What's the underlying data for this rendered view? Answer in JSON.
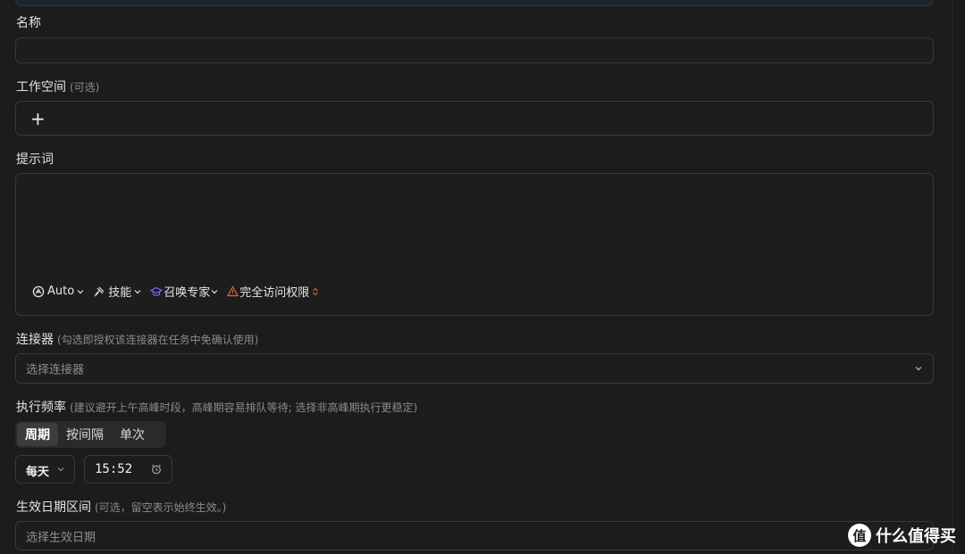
{
  "name": {
    "label": "名称",
    "value": ""
  },
  "workspace": {
    "label": "工作空间",
    "hint": "(可选)",
    "add_symbol": "+"
  },
  "prompt": {
    "label": "提示词",
    "value": "",
    "toolbar": {
      "mode": "Auto",
      "skills": "技能",
      "expert": "召唤专家",
      "access": "完全访问权限"
    }
  },
  "connectors": {
    "label": "连接器",
    "hint": "(勾选即授权该连接器在任务中免确认使用)",
    "placeholder": "选择连接器"
  },
  "frequency": {
    "label": "执行频率",
    "hint": "(建议避开上午高峰时段，高峰期容易排队等待; 选择非高峰期执行更稳定)",
    "tabs": [
      "周期",
      "按间隔",
      "单次"
    ],
    "active_tab": "周期",
    "period": "每天",
    "time": "15:52"
  },
  "date_range": {
    "label": "生效日期区间",
    "hint": "(可选，留空表示始终生效。)",
    "placeholder": "选择生效日期"
  },
  "watermark": {
    "logo": "值",
    "text": "什么值得买"
  },
  "colors": {
    "background": "#1c1c1c",
    "border": "#393939",
    "expert_icon": "#7b6cf6",
    "warning": "#e0663f"
  }
}
